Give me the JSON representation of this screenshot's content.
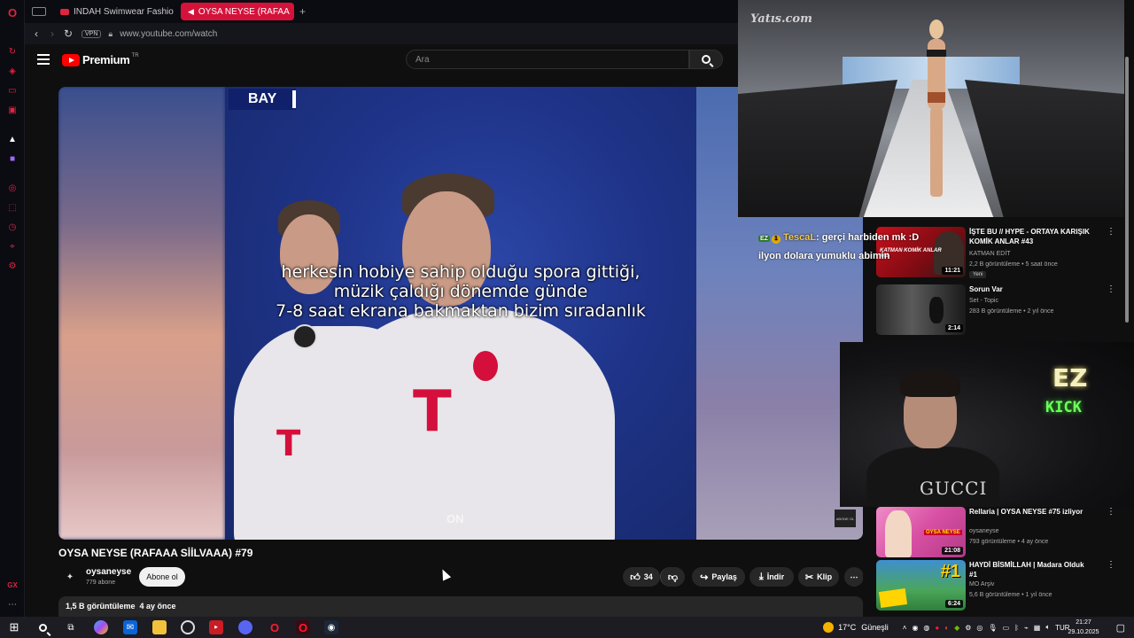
{
  "browser": {
    "tabs": [
      {
        "label": "INDAH Swimwear Fashio",
        "active": false
      },
      {
        "label": "OYSA NEYSE (RAFAA",
        "active": true
      }
    ],
    "new_tab_label": "+",
    "url": "www.youtube.com/watch",
    "vpn_label": "VPN"
  },
  "youtube": {
    "logo_text": "Premium",
    "logo_region": "TR",
    "search_placeholder": "Ara",
    "video": {
      "title": "OYSA NEYSE (RAFAAA SİİLVAAA) #79",
      "subtitle_lines": [
        "herkesin hobiye sahip olduğu spora gittiği,",
        "müzik çaldığı dönemde günde",
        "7-8 saat ekrana bakmaktan bizim sıradanlık"
      ],
      "overlay_tag": "BAY",
      "watermark": "ON",
      "abone_badge": "ABONE OL"
    },
    "channel": {
      "name": "oysaneyse",
      "subscribers": "779 abone",
      "subscribe_label": "Abone ol"
    },
    "actions": {
      "like_count": "34",
      "share_label": "Paylaş",
      "download_label": "İndir",
      "clip_label": "Klip",
      "more_label": "⋯"
    },
    "description": {
      "views": "1,5 B görüntüleme",
      "age": "4 ay önce"
    },
    "recommendations": [
      {
        "title": "İŞTE BU // HYPE - ORTAYA KARIŞIK KOMİK ANLAR #43",
        "channel": "KATMAN EDİT",
        "meta": "2,2 B görüntüleme • 5 saat önce",
        "duration": "11:21",
        "badge": "Yeni",
        "thumb_text": "KATMAN KOMİK ANLAR #43"
      },
      {
        "title": "Sorun Var",
        "channel": "Set - Topic",
        "meta": "283 B görüntüleme • 2 yıl önce",
        "duration": "2:14"
      },
      {
        "title": "Rellaria | OYSA NEYSE #75 izliyor",
        "channel": "oysaneyse",
        "meta": "793 görüntüleme • 4 ay önce",
        "duration": "21:08",
        "thumb_text": "OYSA NEYSE"
      },
      {
        "title": "HAYDİ BİSMİLLAH | Madara Olduk #1",
        "channel": "MO Arşiv",
        "meta": "5,6 B görüntüleme • 1 yıl önce",
        "duration": "6:24",
        "thumb_text": "#1"
      }
    ]
  },
  "overlays": {
    "runway_watermark": "Yatıs.com",
    "chat": {
      "badge_ez": "EZ",
      "badge_one": "1",
      "user": "TescaL",
      "line1": ": gerçi harbiden mk :D",
      "line2": "ilyon dolara yumuklu abimin"
    },
    "webcam": {
      "shirt_text": "GUCCI",
      "neon_ez": "EZ",
      "neon_kick": "KICK"
    }
  },
  "taskbar": {
    "weather": "17°C",
    "weather_desc": "Güneşli",
    "language": "TUR",
    "time": "21:27",
    "date": "29.10.2025"
  }
}
